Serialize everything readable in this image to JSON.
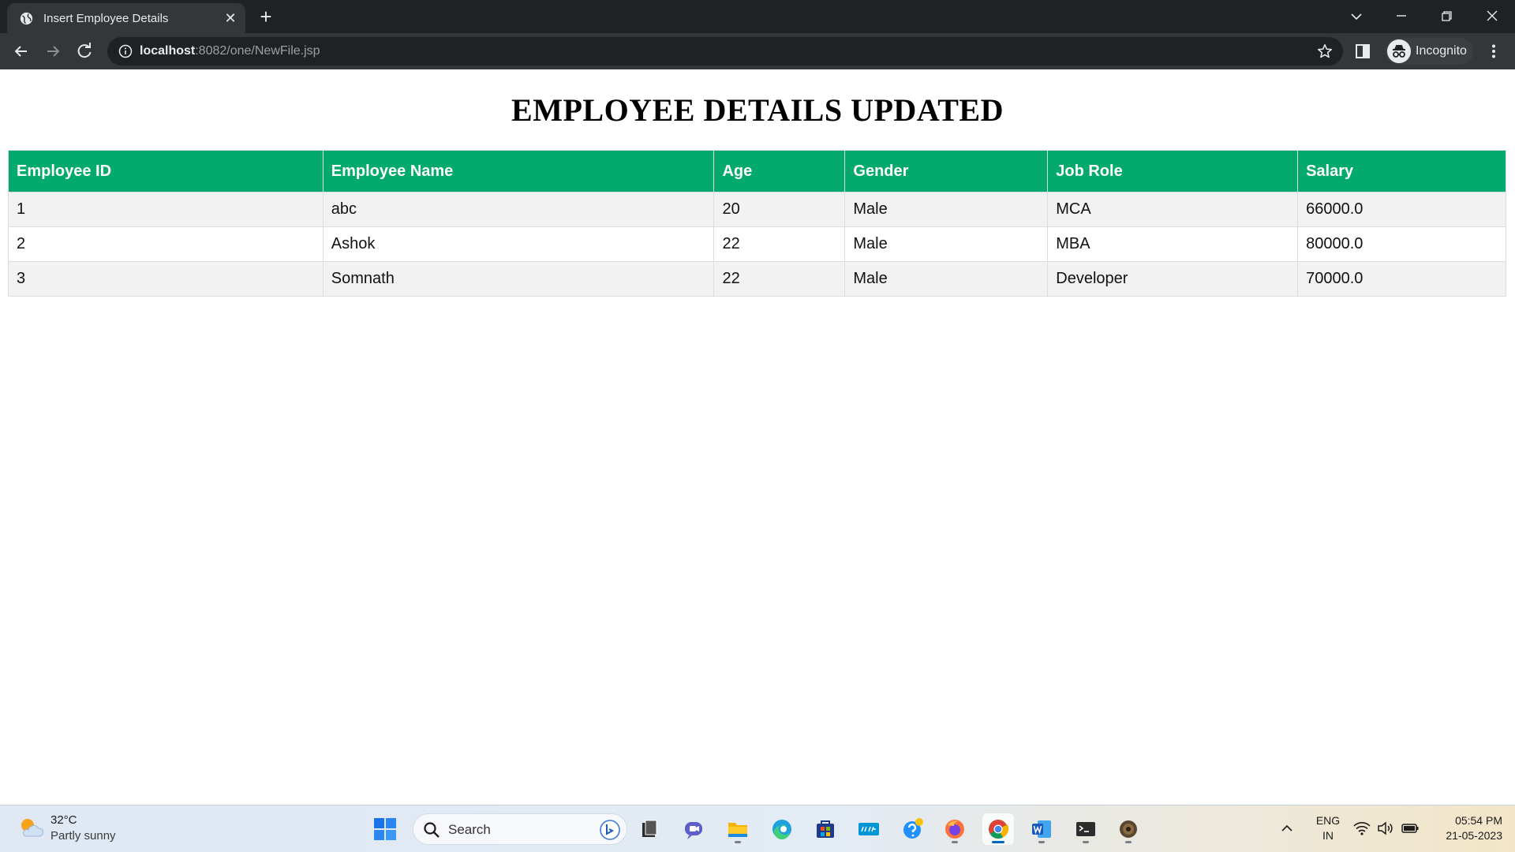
{
  "browser": {
    "tab_title": "Insert Employee Details",
    "url_host": "localhost",
    "url_rest": ":8082/one/NewFile.jsp",
    "profile_label": "Incognito"
  },
  "page": {
    "heading": "EMPLOYEE DETAILS UPDATED",
    "table": {
      "headers": [
        "Employee ID",
        "Employee Name",
        "Age",
        "Gender",
        "Job Role",
        "Salary"
      ],
      "rows": [
        [
          "1",
          "abc",
          "20",
          "Male",
          "MCA",
          "66000.0"
        ],
        [
          "2",
          "Ashok",
          "22",
          "Male",
          "MBA",
          "80000.0"
        ],
        [
          "3",
          "Somnath",
          "22",
          "Male",
          "Developer",
          "70000.0"
        ]
      ],
      "header_color": "#04aa6d",
      "stripe_color": "#f2f2f2"
    }
  },
  "taskbar": {
    "weather_temp": "32°C",
    "weather_desc": "Partly sunny",
    "search_placeholder": "Search",
    "apps": [
      "file-manager-icon",
      "teams-chat-icon",
      "file-explorer-icon",
      "edge-icon",
      "store-icon",
      "myhp-icon",
      "get-help-icon",
      "firefox-icon",
      "chrome-icon",
      "word-icon",
      "terminal-icon",
      "settings-app-icon"
    ],
    "lang_line1": "ENG",
    "lang_line2": "IN",
    "time": "05:54 PM",
    "date": "21-05-2023"
  }
}
